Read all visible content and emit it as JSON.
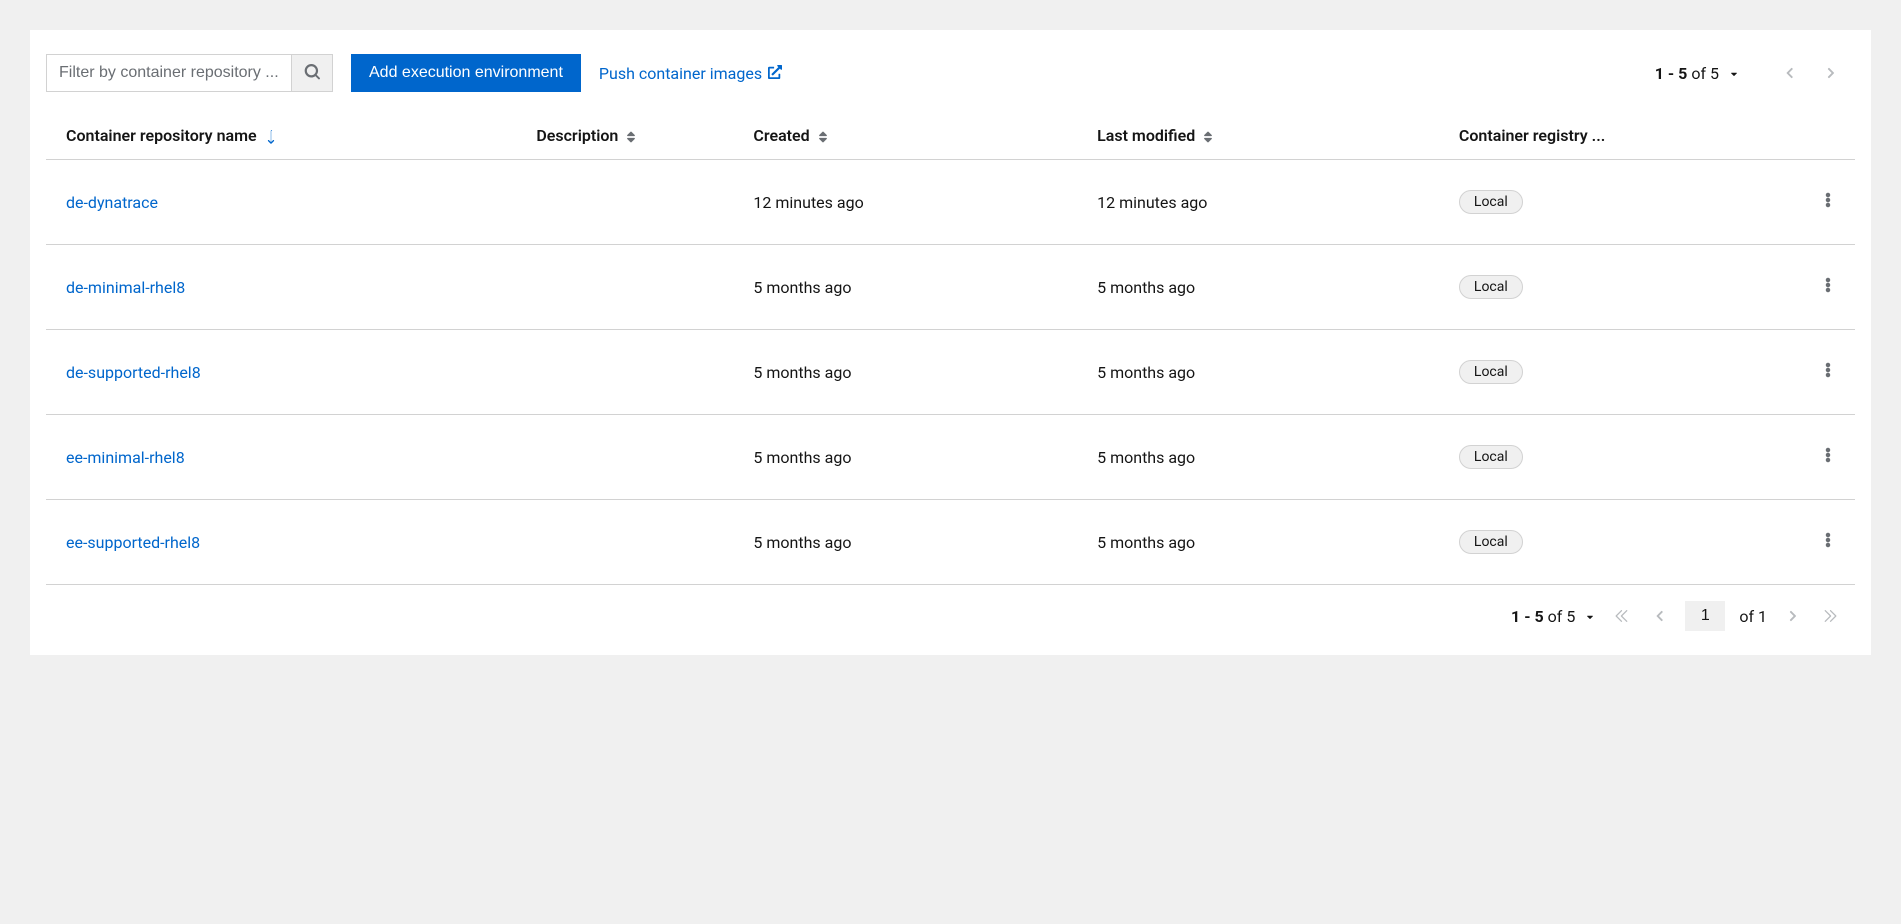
{
  "toolbar": {
    "filter_placeholder": "Filter by container repository ...",
    "add_label": "Add execution environment",
    "push_label": "Push container images"
  },
  "columns": {
    "name": "Container repository name",
    "description": "Description",
    "created": "Created",
    "modified": "Last modified",
    "registry": "Container registry ..."
  },
  "rows": [
    {
      "name": "de-dynatrace",
      "description": "",
      "created": "12 minutes ago",
      "modified": "12 minutes ago",
      "registry": "Local"
    },
    {
      "name": "de-minimal-rhel8",
      "description": "",
      "created": "5 months ago",
      "modified": "5 months ago",
      "registry": "Local"
    },
    {
      "name": "de-supported-rhel8",
      "description": "",
      "created": "5 months ago",
      "modified": "5 months ago",
      "registry": "Local"
    },
    {
      "name": "ee-minimal-rhel8",
      "description": "",
      "created": "5 months ago",
      "modified": "5 months ago",
      "registry": "Local"
    },
    {
      "name": "ee-supported-rhel8",
      "description": "",
      "created": "5 months ago",
      "modified": "5 months ago",
      "registry": "Local"
    }
  ],
  "pagination": {
    "range_bold": "1 - 5",
    "of": "of",
    "total": "5",
    "current_page": "1",
    "total_pages": "1"
  }
}
